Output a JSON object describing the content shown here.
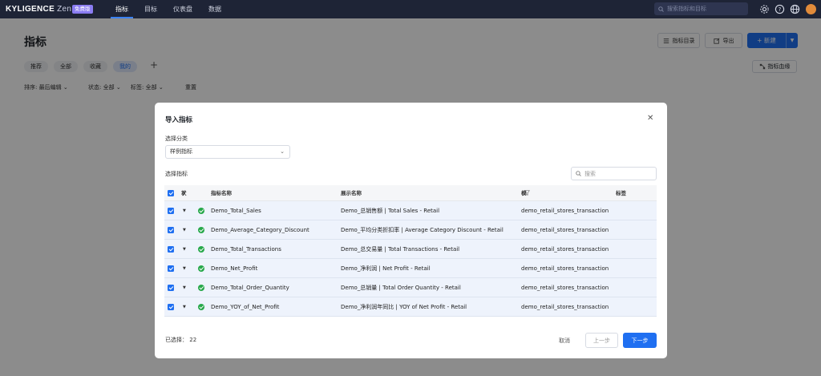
{
  "topnav": {
    "logo": "KYLIGENCE",
    "logo_suffix": "Zen",
    "badge": "免费版",
    "tabs": [
      {
        "label": "指标",
        "active": true
      },
      {
        "label": "目标",
        "active": false
      },
      {
        "label": "仪表盘",
        "active": false
      },
      {
        "label": "数据",
        "active": false
      }
    ],
    "search_placeholder": "搜索指标和目标",
    "icons": [
      "settings-icon",
      "help-icon",
      "globe-icon",
      "avatar"
    ]
  },
  "page": {
    "title": "指标",
    "catalog_label": "指标目录",
    "export_label": "导出",
    "new_label": "新建",
    "kanban_label": "指标血缘",
    "tabs": [
      {
        "label": "推荐",
        "active": false
      },
      {
        "label": "全部",
        "active": false
      },
      {
        "label": "收藏",
        "active": false
      },
      {
        "label": "我的",
        "active": true
      }
    ],
    "filters": {
      "sort_label": "排序:",
      "sort_value": "最后编辑",
      "status_label": "状态:",
      "status_value": "全部",
      "tag_label": "标签:",
      "tag_value": "全部",
      "reset_label": "重置"
    }
  },
  "modal": {
    "title": "导入指标",
    "category_label": "选择分类",
    "category_value": "样例指标",
    "select_label": "选择指标",
    "search_placeholder": "搜索",
    "columns": {
      "status": "状态",
      "name": "指标名称",
      "display": "展示名称",
      "model": "模型名",
      "tags": "标签"
    },
    "rows": [
      {
        "name": "Demo_Total_Sales",
        "display": "Demo_总销售额 | Total Sales - Retail",
        "model": "demo_retail_stores_transaction"
      },
      {
        "name": "Demo_Average_Category_Discount",
        "display": "Demo_平均分类折扣率 | Average Category Discount - Retail",
        "model": "demo_retail_stores_transaction"
      },
      {
        "name": "Demo_Total_Transactions",
        "display": "Demo_总交易量 | Total Transactions - Retail",
        "model": "demo_retail_stores_transaction"
      },
      {
        "name": "Demo_Net_Profit",
        "display": "Demo_净利润 | Net Profit - Retail",
        "model": "demo_retail_stores_transaction"
      },
      {
        "name": "Demo_Total_Order_Quantity",
        "display": "Demo_总销量 | Total Order Quantity - Retail",
        "model": "demo_retail_stores_transaction"
      },
      {
        "name": "Demo_YOY_of_Net_Profit",
        "display": "Demo_净利润年同比 | YOY of Net Profit - Retail",
        "model": "demo_retail_stores_transaction"
      }
    ],
    "selected_label": "已选择：",
    "selected_count": "22",
    "cancel_label": "取消",
    "prev_label": "上一步",
    "next_label": "下一步"
  },
  "colors": {
    "nav_bg": "#1e2436",
    "primary": "#1f6ff1",
    "success": "#27a84a",
    "badge": "#8a7cf2"
  }
}
